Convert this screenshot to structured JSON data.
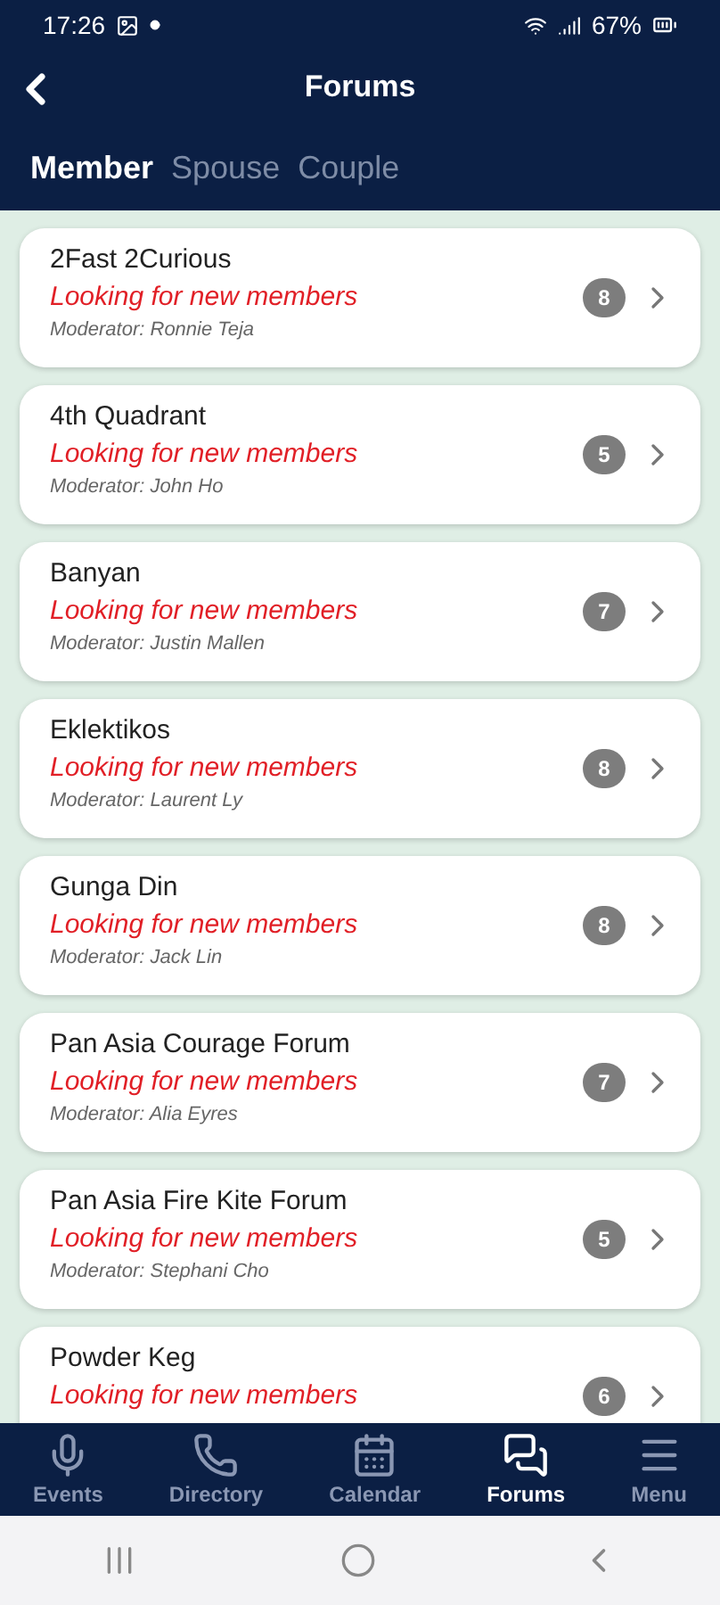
{
  "status_bar": {
    "time": "17:26",
    "battery": "67%"
  },
  "header": {
    "title": "Forums"
  },
  "tabs": [
    {
      "label": "Member",
      "selected": true
    },
    {
      "label": "Spouse",
      "selected": false
    },
    {
      "label": "Couple",
      "selected": false
    }
  ],
  "forums": [
    {
      "name": "2Fast 2Curious",
      "status": "Looking for new members",
      "moderator": "Moderator: Ronnie Teja",
      "count": "8"
    },
    {
      "name": "4th Quadrant",
      "status": "Looking for new members",
      "moderator": "Moderator: John Ho",
      "count": "5"
    },
    {
      "name": "Banyan",
      "status": "Looking for new members",
      "moderator": "Moderator: Justin Mallen",
      "count": "7"
    },
    {
      "name": "Eklektikos",
      "status": "Looking for new members",
      "moderator": "Moderator: Laurent Ly",
      "count": "8"
    },
    {
      "name": "Gunga Din",
      "status": "Looking for new members",
      "moderator": "Moderator: Jack Lin",
      "count": "8"
    },
    {
      "name": "Pan Asia Courage Forum",
      "status": "Looking for new members",
      "moderator": "Moderator: Alia Eyres",
      "count": "7"
    },
    {
      "name": "Pan Asia Fire Kite Forum",
      "status": "Looking for new members",
      "moderator": "Moderator: Stephani Cho",
      "count": "5"
    },
    {
      "name": "Powder Keg",
      "status": "Looking for new members",
      "count": "6"
    }
  ],
  "bottom_nav": [
    {
      "kind": "mic",
      "label": "Events",
      "selected": false
    },
    {
      "kind": "phone",
      "label": "Directory",
      "selected": false
    },
    {
      "kind": "calendar",
      "label": "Calendar",
      "selected": false
    },
    {
      "kind": "chat",
      "label": "Forums",
      "selected": true
    },
    {
      "kind": "menu",
      "label": "Menu",
      "selected": false
    }
  ]
}
